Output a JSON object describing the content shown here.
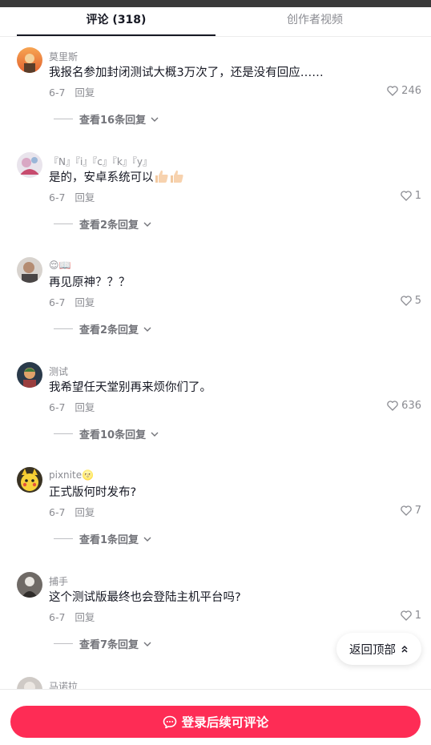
{
  "tabs": [
    {
      "label": "评论 (318)",
      "active": true
    },
    {
      "label": "创作者视频",
      "active": false
    }
  ],
  "comments": [
    {
      "author": "莫里斯",
      "text": "我报名参加封闭测试大概3万次了，还是没有回应……",
      "date": "6-7",
      "reply_label": "回复",
      "likes": "246",
      "view_replies": "查看16条回复"
    },
    {
      "author": "『N』『i』『c』『k』『y』",
      "text": "是的，安卓系统可以",
      "date": "6-7",
      "reply_label": "回复",
      "likes": "1",
      "view_replies": "查看2条回复"
    },
    {
      "author": "😌📖",
      "text": "再见原神？？？",
      "date": "6-7",
      "reply_label": "回复",
      "likes": "5",
      "view_replies": "查看2条回复"
    },
    {
      "author": "测试",
      "text": "我希望任天堂别再来烦你们了。",
      "date": "6-7",
      "reply_label": "回复",
      "likes": "636",
      "view_replies": "查看10条回复"
    },
    {
      "author": "pixnite🌝",
      "text": "正式版何时发布?",
      "date": "6-7",
      "reply_label": "回复",
      "likes": "7",
      "view_replies": "查看1条回复"
    },
    {
      "author": "捕手",
      "text": "这个测试版最终也会登陆主机平台吗?",
      "date": "6-7",
      "reply_label": "回复",
      "likes": "1",
      "view_replies": "查看7条回复"
    },
    {
      "author": "马诺拉",
      "text": "",
      "date": "",
      "reply_label": "",
      "likes": "",
      "view_replies": ""
    }
  ],
  "back_to_top": "返回顶部",
  "login_button": "登录后续可评论",
  "colors": {
    "accent": "#fe2c55",
    "text": "#161823",
    "muted": "#8a8b91"
  },
  "icons": [
    "heart-outline-icon",
    "chevron-down-icon",
    "double-chevron-up-icon",
    "chat-bubble-icon",
    "thumbs-up-emoji"
  ]
}
